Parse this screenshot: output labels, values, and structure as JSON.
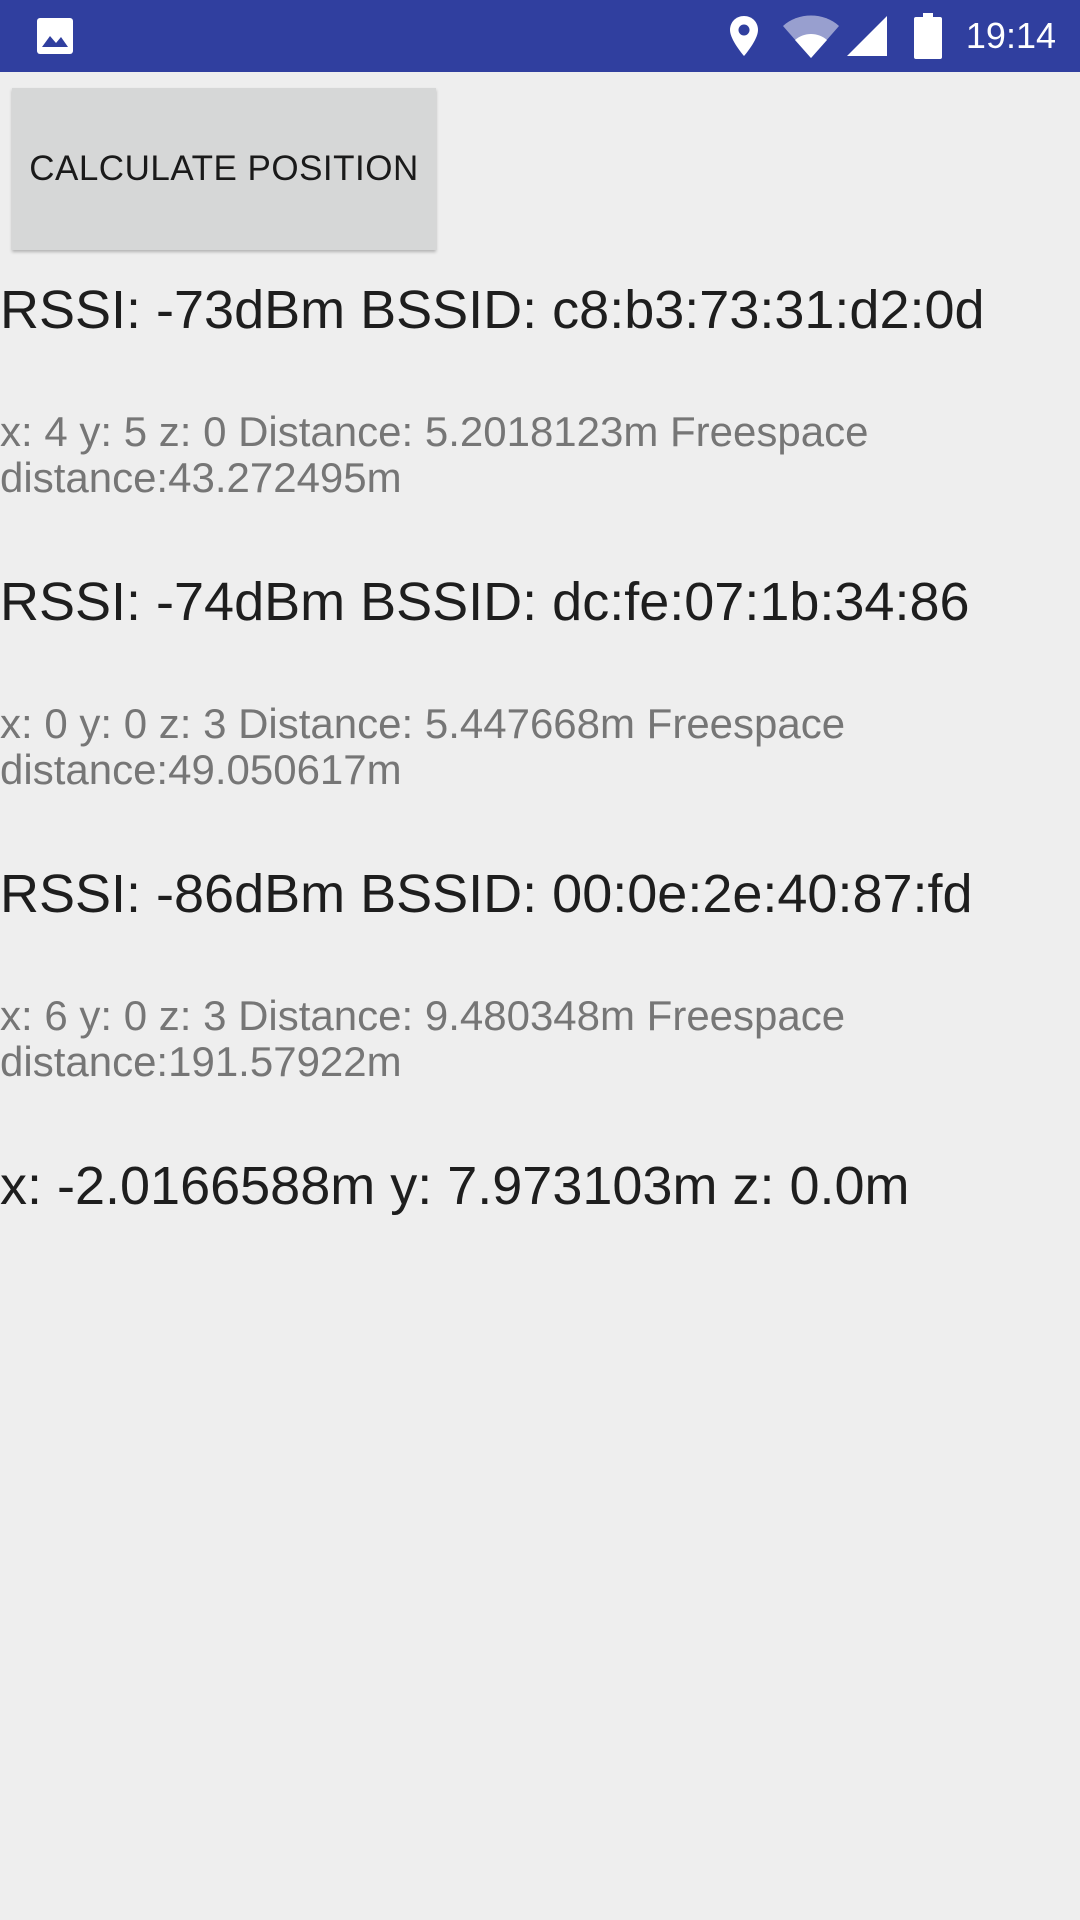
{
  "status_bar": {
    "time": "19:14",
    "icons": [
      "image-icon",
      "location-icon",
      "wifi-icon",
      "signal-icon",
      "battery-icon"
    ],
    "background_color": "#303f9f"
  },
  "button": {
    "label": "CALCULATE POSITION"
  },
  "access_points": [
    {
      "rssi_line": "RSSI: -73dBm BSSID: c8:b3:73:31:d2:0d",
      "detail_line": "x: 4 y: 5 z: 0 Distance: 5.2018123m Freespace distance:43.272495m"
    },
    {
      "rssi_line": "RSSI: -74dBm BSSID: dc:fe:07:1b:34:86",
      "detail_line": "x: 0 y: 0 z: 3 Distance: 5.447668m Freespace distance:49.050617m"
    },
    {
      "rssi_line": "RSSI: -86dBm BSSID: 00:0e:2e:40:87:fd",
      "detail_line": "x: 6 y: 0 z: 3 Distance: 9.480348m Freespace distance:191.57922m"
    }
  ],
  "result": {
    "position_line": "x: -2.0166588m y: 7.973103m z: 0.0m"
  }
}
